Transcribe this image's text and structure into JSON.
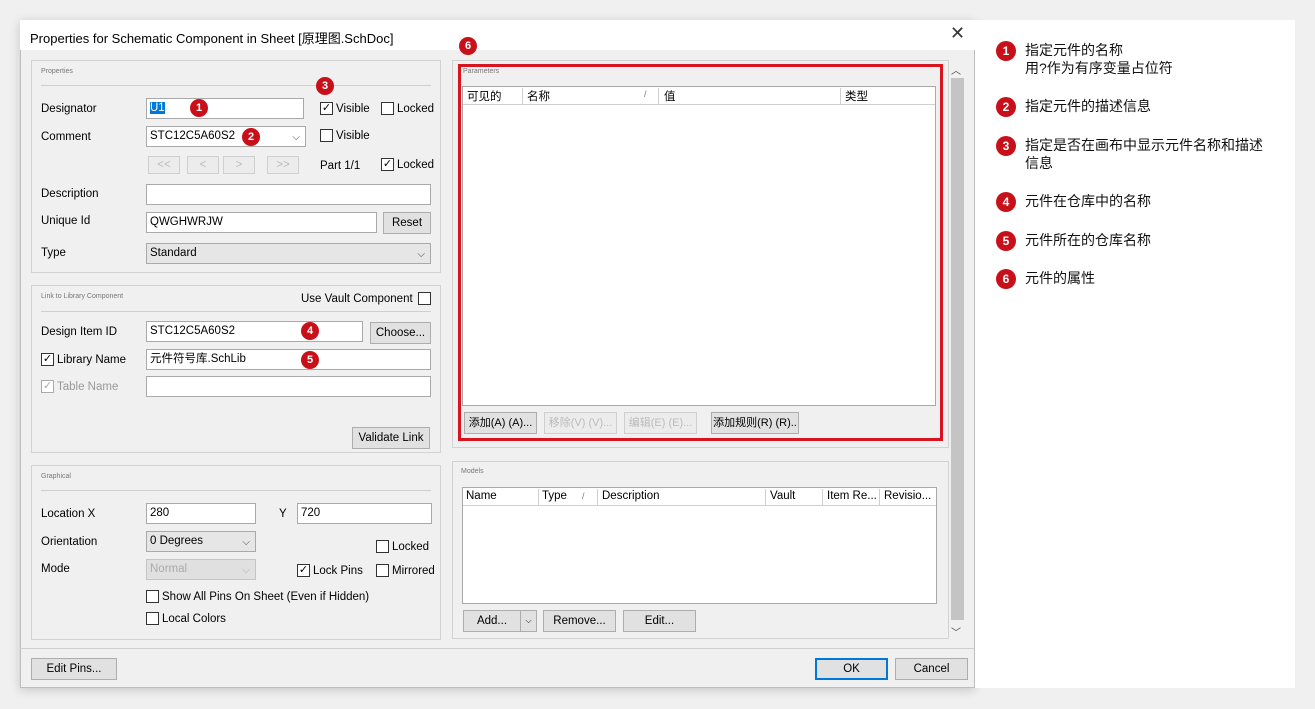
{
  "dialog": {
    "title": "Properties for Schematic Component in Sheet [原理图.SchDoc]",
    "close_glyph": "✕",
    "edit_pins_label": "Edit Pins...",
    "ok_label": "OK",
    "cancel_label": "Cancel"
  },
  "properties": {
    "group_title": "Properties",
    "designator_label": "Designator",
    "designator_value": "U1",
    "visible_label": "Visible",
    "locked_label": "Locked",
    "comment_label": "Comment",
    "comment_value": "STC12C5A60S2",
    "nav_first": "<<",
    "nav_prev": "<",
    "nav_next": ">",
    "nav_last": ">>",
    "part_label": "Part 1/1",
    "description_label": "Description",
    "description_value": "",
    "unique_id_label": "Unique Id",
    "unique_id_value": "QWGHWRJW",
    "reset_label": "Reset",
    "type_label": "Type",
    "type_value": "Standard"
  },
  "library_link": {
    "group_title": "Link to Library Component",
    "use_vault_label": "Use Vault Component",
    "design_item_label": "Design Item ID",
    "design_item_value": "STC12C5A60S2",
    "choose_label": "Choose...",
    "library_name_label": "Library Name",
    "library_name_value": "元件符号库.SchLib",
    "table_name_label": "Table Name",
    "table_name_value": "",
    "validate_label": "Validate Link"
  },
  "graphical": {
    "group_title": "Graphical",
    "location_label": "Location  X",
    "x_value": "280",
    "y_label": "Y",
    "y_value": "720",
    "orientation_label": "Orientation",
    "orientation_value": "0 Degrees",
    "locked_label": "Locked",
    "mode_label": "Mode",
    "mode_value": "Normal",
    "lock_pins_label": "Lock Pins",
    "mirrored_label": "Mirrored",
    "show_all_pins_label": "Show All Pins On Sheet (Even if Hidden)",
    "local_colors_label": "Local Colors"
  },
  "parameters": {
    "group_title": "Parameters",
    "columns": [
      "可见的",
      "名称",
      "值",
      "类型"
    ],
    "add_label": "添加(A) (A)...",
    "remove_label": "移除(V) (V)...",
    "edit_label": "编辑(E) (E)...",
    "add_rule_label": "添加规则(R) (R).."
  },
  "models": {
    "group_title": "Models",
    "columns": [
      "Name",
      "Type",
      "Description",
      "Vault",
      "Item Re...",
      "Revisio..."
    ],
    "add_label": "Add...",
    "remove_label": "Remove...",
    "edit_label": "Edit..."
  },
  "badges": [
    "1",
    "2",
    "3",
    "4",
    "5",
    "6"
  ],
  "annotations": [
    {
      "num": "1",
      "text": "指定元件的名称\n用?作为有序变量占位符"
    },
    {
      "num": "2",
      "text": "指定元件的描述信息"
    },
    {
      "num": "3",
      "text": "指定是否在画布中显示元件名称和描述信息"
    },
    {
      "num": "4",
      "text": "元件在仓库中的名称"
    },
    {
      "num": "5",
      "text": "元件所在的仓库名称"
    },
    {
      "num": "6",
      "text": "元件的属性"
    }
  ],
  "icons": {
    "check": "✓",
    "dropdown": "⌵",
    "sort": "/",
    "scroll_up": "︿",
    "scroll_down": "﹀"
  },
  "colors": {
    "badge_red": "#c8101a",
    "highlight_border": "#d8141f",
    "ok_border": "#0078d7"
  }
}
